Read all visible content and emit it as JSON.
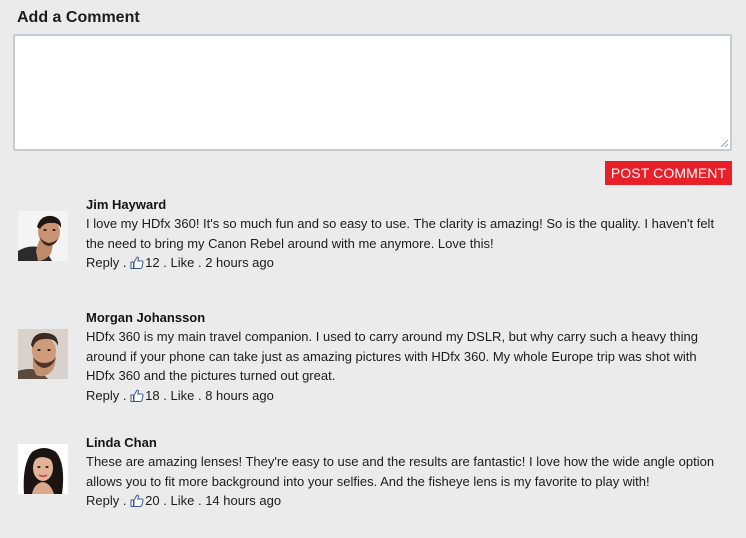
{
  "heading": "Add a Comment",
  "comment_input": {
    "value": "",
    "placeholder": ""
  },
  "post_button": "POST COMMENT",
  "accent_color": "#e8202a",
  "like_icon_color": "#3b5998",
  "comments": [
    {
      "author": "Jim Hayward",
      "text": "I love my HDfx 360! It's so much fun and so easy to use. The clarity is amazing! So is the quality. I haven't felt the need to bring my Canon Rebel around with me anymore. Love this!",
      "reply": "Reply",
      "likes": "12",
      "like": "Like",
      "time": "2 hours ago"
    },
    {
      "author": "Morgan Johansson",
      "text": "HDfx 360 is my main travel companion. I used to carry around my DSLR, but why carry such a heavy thing around if your phone can take just as amazing pictures with HDfx 360. My whole Europe trip was shot with HDfx 360 and the pictures turned out great.",
      "reply": "Reply",
      "likes": "18",
      "like": "Like",
      "time": "8 hours ago"
    },
    {
      "author": "Linda Chan",
      "text": "These are amazing lenses! They're easy to use and the results are fantastic! I love how the wide angle option allows you to fit more background into your selfies. And the fisheye lens is my favorite to play with!",
      "reply": "Reply",
      "likes": "20",
      "like": "Like",
      "time": "14 hours ago"
    }
  ],
  "separator": "."
}
